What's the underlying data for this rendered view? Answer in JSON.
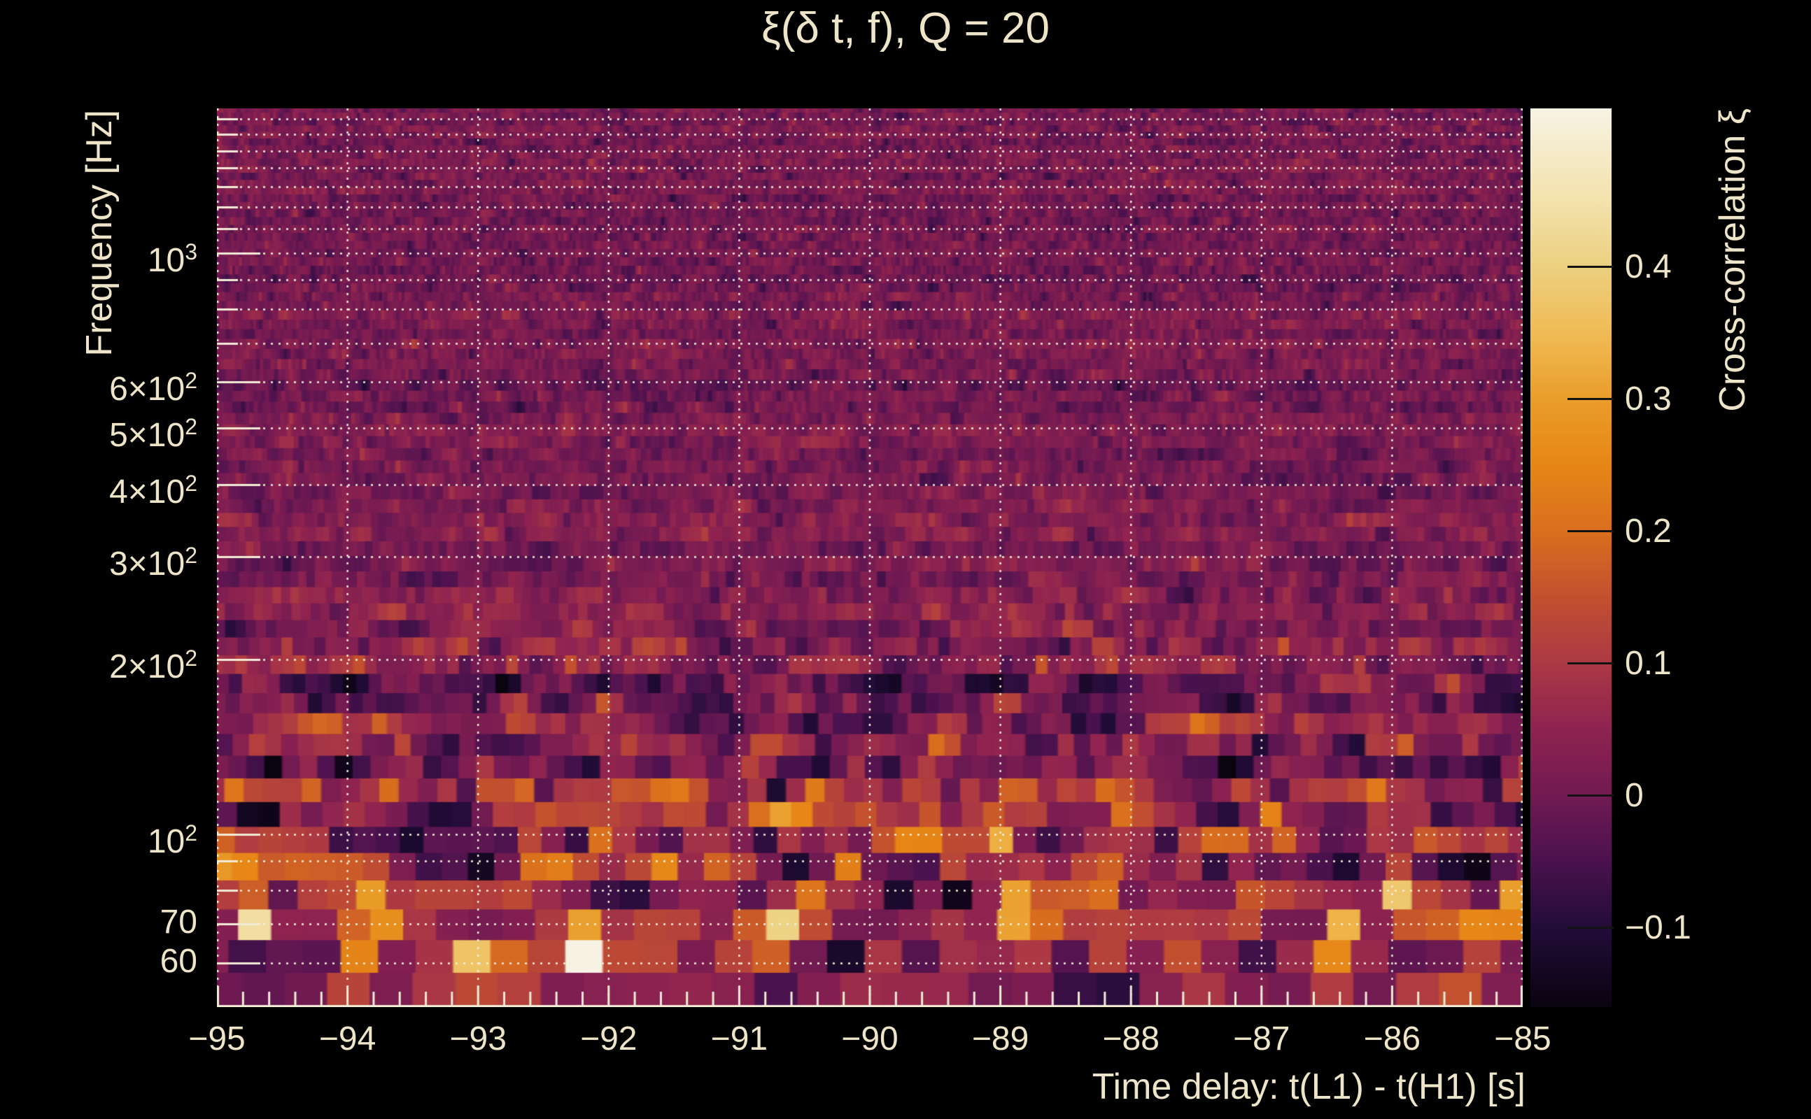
{
  "title": "ξ(δ t, f), Q = 20",
  "colors": {
    "background": "#000000",
    "text": "#eee5c9",
    "grid": "#f6efdb",
    "tick": "#f2ecd7",
    "colorbar_tick": "#131313"
  },
  "chart_data": {
    "type": "heatmap",
    "title": "ξ(δ t, f), Q = 20",
    "xlabel": "Time delay: t(L1) - t(H1) [s]",
    "ylabel": "Frequency [Hz]",
    "colorbar_label": "Cross-correlation ξ",
    "x_range": [
      -95,
      -85
    ],
    "x_ticks": [
      {
        "value": -95,
        "label": "−95"
      },
      {
        "value": -94,
        "label": "−94"
      },
      {
        "value": -93,
        "label": "−93"
      },
      {
        "value": -92,
        "label": "−92"
      },
      {
        "value": -91,
        "label": "−91"
      },
      {
        "value": -90,
        "label": "−90"
      },
      {
        "value": -89,
        "label": "−89"
      },
      {
        "value": -88,
        "label": "−88"
      },
      {
        "value": -87,
        "label": "−87"
      },
      {
        "value": -86,
        "label": "−86"
      },
      {
        "value": -85,
        "label": "−85"
      }
    ],
    "x_minor_step": 0.2,
    "y_scale": "log",
    "y_range_hz": [
      50.4,
      1774
    ],
    "y_ticks": [
      {
        "f": 1000,
        "mantissa": "10",
        "exp": "3"
      },
      {
        "f": 600,
        "mantissa": "6×10",
        "exp": "2"
      },
      {
        "f": 500,
        "mantissa": "5×10",
        "exp": "2"
      },
      {
        "f": 400,
        "mantissa": "4×10",
        "exp": "2"
      },
      {
        "f": 300,
        "mantissa": "3×10",
        "exp": "2"
      },
      {
        "f": 200,
        "mantissa": "2×10",
        "exp": "2"
      },
      {
        "f": 100,
        "mantissa": "10",
        "exp": "2"
      },
      {
        "f": 70,
        "mantissa": "70",
        "exp": ""
      },
      {
        "f": 60,
        "mantissa": "60",
        "exp": ""
      }
    ],
    "y_gridlines_hz": [
      60,
      70,
      80,
      90,
      100,
      200,
      300,
      400,
      500,
      600,
      700,
      800,
      900,
      1000,
      1100,
      1200,
      1300,
      1400,
      1500,
      1600,
      1700
    ],
    "colorbar": {
      "min": -0.16,
      "max": 0.52,
      "ticks": [
        {
          "value": 0.4,
          "label": "0.4"
        },
        {
          "value": 0.3,
          "label": "0.3"
        },
        {
          "value": 0.2,
          "label": "0.2"
        },
        {
          "value": 0.1,
          "label": "0.1"
        },
        {
          "value": 0.0,
          "label": "0"
        },
        {
          "value": -0.1,
          "label": "−0.1"
        }
      ]
    },
    "colormap_stops": [
      [
        -0.16,
        "#0a0310"
      ],
      [
        -0.1,
        "#220c38"
      ],
      [
        -0.05,
        "#4a124e"
      ],
      [
        0.0,
        "#711a52"
      ],
      [
        0.05,
        "#8e2350"
      ],
      [
        0.1,
        "#ab3844"
      ],
      [
        0.15,
        "#c2502f"
      ],
      [
        0.2,
        "#d96f1e"
      ],
      [
        0.25,
        "#e68617"
      ],
      [
        0.3,
        "#e99d2a"
      ],
      [
        0.35,
        "#f0bb55"
      ],
      [
        0.4,
        "#ecd080"
      ],
      [
        0.45,
        "#f3e2ac"
      ],
      [
        0.52,
        "#f7f3e4"
      ]
    ],
    "hotspots": [
      [
        -92.22,
        64,
        0.56
      ],
      [
        -90.62,
        66,
        0.44
      ],
      [
        -93.8,
        74,
        0.4
      ],
      [
        -94.72,
        72,
        0.34
      ],
      [
        -93.92,
        58,
        0.3
      ],
      [
        -94.95,
        90,
        0.3
      ],
      [
        -92.98,
        62,
        0.26
      ],
      [
        -88.95,
        98,
        0.26
      ],
      [
        -88.85,
        70,
        0.32
      ],
      [
        -85.95,
        80,
        0.3
      ],
      [
        -87.12,
        80,
        0.24
      ],
      [
        -86.42,
        60,
        0.26
      ],
      [
        -87.5,
        58,
        0.24
      ],
      [
        -91.4,
        110,
        0.22
      ],
      [
        -89.45,
        140,
        0.2
      ],
      [
        -86.95,
        105,
        0.22
      ],
      [
        -90.15,
        88,
        0.24
      ],
      [
        -85.35,
        57,
        0.3
      ],
      [
        -85.1,
        79,
        0.26
      ],
      [
        -91.9,
        130,
        0.18
      ],
      [
        -94.35,
        120,
        0.2
      ],
      [
        -92.6,
        95,
        0.22
      ],
      [
        -88.3,
        60,
        0.22
      ],
      [
        -86.3,
        72,
        0.28
      ]
    ],
    "texture": {
      "seed": 20,
      "mean": 0.012,
      "sigma_base": 0.028,
      "corr": 0.5,
      "hotspot_sigma_t": 0.1,
      "hotspot_sigma_logf": 0.03,
      "low_band": {
        "center_log": 1.93,
        "sigma_log": 0.16,
        "sigma_boost": 0.06,
        "mean_boost": 0.03
      },
      "mid_band": {
        "center_log": 2.25,
        "sigma_log": 0.12,
        "sigma_boost": 0.018,
        "mean_boost": 0.008
      },
      "tiling": {
        "f_min": 50.4,
        "f_max": 1774,
        "row_coeff": 1.05,
        "tile_coeff": 3300,
        "tile_min": 4,
        "tile_max": 62
      }
    }
  }
}
